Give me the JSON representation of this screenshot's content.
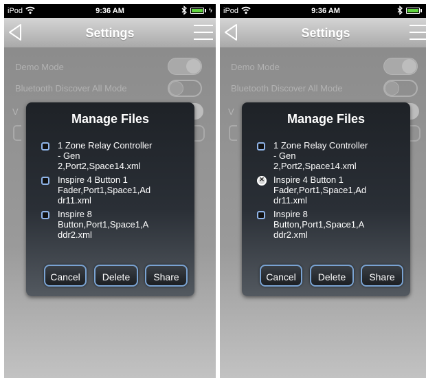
{
  "status_bar": {
    "carrier": "iPod",
    "time": "9:36 AM"
  },
  "nav": {
    "title": "Settings",
    "back_icon": "back-arrow-icon",
    "menu_icon": "hamburger-menu-icon"
  },
  "settings": [
    {
      "label": "Demo Mode",
      "enabled": true
    },
    {
      "label": "Bluetooth Discover All Mode",
      "enabled": false
    }
  ],
  "partial_row_letter": "V",
  "dialog": {
    "title": "Manage Files",
    "buttons": {
      "cancel": "Cancel",
      "delete": "Delete",
      "share": "Share"
    }
  },
  "screens": [
    {
      "files": [
        {
          "name": "1 Zone Relay Controller\n- Gen\n2,Port2,Space14.xml",
          "checked": false
        },
        {
          "name": "Inspire 4 Button 1\nFader,Port1,Space1,Ad\ndr11.xml",
          "checked": false
        },
        {
          "name": "Inspire 8\nButton,Port1,Space1,A\nddr2.xml",
          "checked": false
        }
      ]
    },
    {
      "files": [
        {
          "name": "1 Zone Relay Controller\n- Gen\n2,Port2,Space14.xml",
          "checked": false
        },
        {
          "name": "Inspire 4 Button 1\nFader,Port1,Space1,Ad\ndr11.xml",
          "checked": true
        },
        {
          "name": "Inspire 8\nButton,Port1,Space1,A\nddr2.xml",
          "checked": false
        }
      ]
    }
  ],
  "colors": {
    "battery": "#5fd33d",
    "button_border": "#7aa3d2"
  }
}
